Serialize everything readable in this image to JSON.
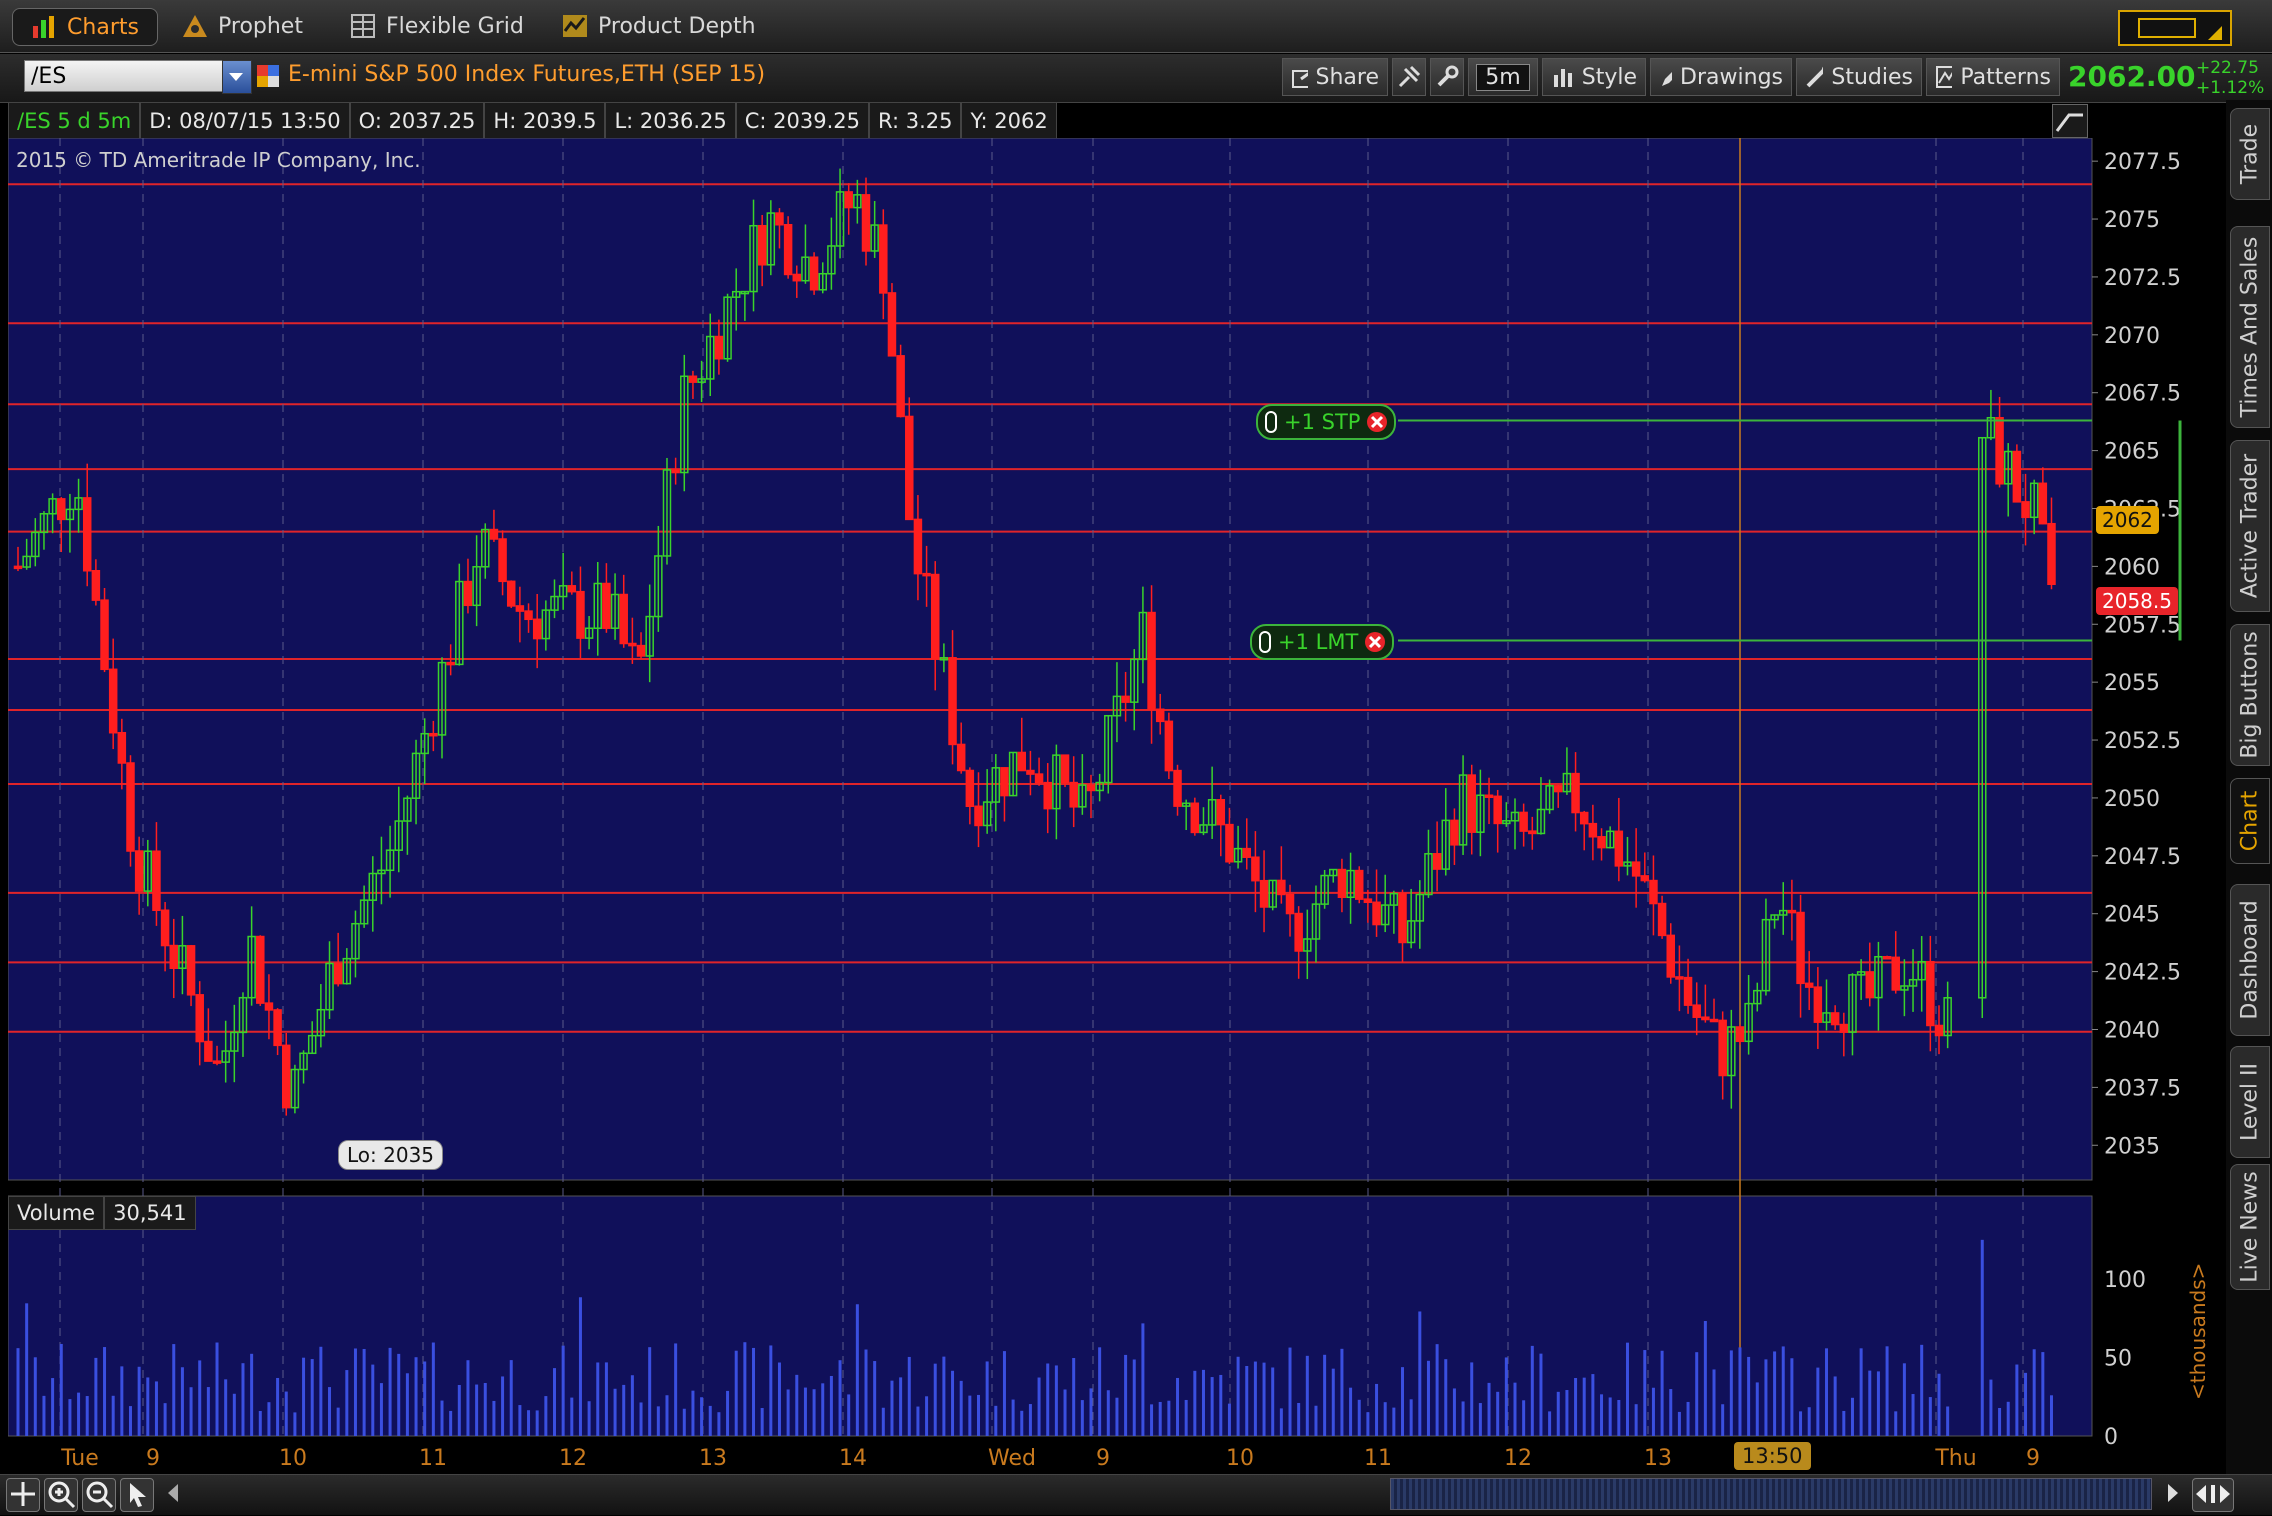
{
  "tabs": [
    {
      "label": "Charts",
      "icon": "charts-icon"
    },
    {
      "label": "Prophet",
      "icon": "prophet-icon"
    },
    {
      "label": "Flexible Grid",
      "icon": "grid-icon"
    },
    {
      "label": "Product Depth",
      "icon": "depth-icon"
    }
  ],
  "header": {
    "symbol": "/ES",
    "description": "E-mini S&P 500 Index Futures,ETH (SEP 15)",
    "buttons": {
      "share": "Share",
      "timeframe": "5m",
      "style": "Style",
      "drawings": "Drawings",
      "studies": "Studies",
      "patterns": "Patterns"
    },
    "last_price": "2062.00",
    "net_change": "+22.75",
    "pct_change": "+1.12%"
  },
  "info": {
    "period": "/ES 5 d 5m",
    "date": "D: 08/07/15 13:50",
    "open": "O: 2037.25",
    "high": "H: 2039.5",
    "low": "L: 2036.25",
    "close": "C: 2039.25",
    "range": "R: 3.25",
    "y": "Y: 2062"
  },
  "chart": {
    "copyright": "2015 © TD Ameritrade IP Company, Inc.",
    "lo_label": "Lo: 2035",
    "price_badge": "2062",
    "bid_badge": "2058.5",
    "orders": {
      "stop": "+1 STP",
      "limit": "+1 LMT"
    },
    "volume_label": "Volume",
    "volume_value": "30,541",
    "volume_unit": "<thousands>",
    "cursor_time": "13:50"
  },
  "chart_data": {
    "type": "candlestick",
    "price_axis": {
      "min": 2033.5,
      "max": 2078.5,
      "ticks": [
        "2077.5",
        "2075",
        "2072.5",
        "2070",
        "2067.5",
        "2065",
        "2062.5",
        "2060",
        "2057.5",
        "2055",
        "2052.5",
        "2050",
        "2047.5",
        "2045",
        "2042.5",
        "2040",
        "2037.5",
        "2035"
      ]
    },
    "volume_axis": {
      "max": 130,
      "ticks": [
        "100",
        "50",
        "0"
      ]
    },
    "x_labels": [
      "Tue",
      "9",
      "10",
      "11",
      "12",
      "13",
      "14",
      "Wed",
      "9",
      "10",
      "11",
      "12",
      "13",
      "Thu",
      "9"
    ],
    "horizontal_levels": [
      2076.5,
      2070.5,
      2067,
      2064.2,
      2061.5,
      2056,
      2053.8,
      2050.6,
      2045.9,
      2042.9,
      2039.9
    ],
    "orders": {
      "stop": 2066.3,
      "limit": 2056.8
    },
    "last": 2062,
    "bid": 2058.5,
    "low": 2035,
    "waypoints": [
      [
        0,
        2060
      ],
      [
        20,
        2064
      ],
      [
        40,
        2048
      ],
      [
        70,
        2038
      ],
      [
        80,
        2044
      ],
      [
        95,
        2037
      ],
      [
        110,
        2043
      ],
      [
        130,
        2048
      ],
      [
        160,
        2061
      ],
      [
        175,
        2058
      ],
      [
        205,
        2058
      ],
      [
        215,
        2055
      ],
      [
        230,
        2067
      ],
      [
        260,
        2075
      ],
      [
        275,
        2073
      ],
      [
        290,
        2076
      ],
      [
        300,
        2073
      ],
      [
        310,
        2061
      ],
      [
        330,
        2050
      ],
      [
        350,
        2052
      ],
      [
        370,
        2049
      ],
      [
        390,
        2057
      ],
      [
        400,
        2051
      ],
      [
        420,
        2048
      ],
      [
        440,
        2044
      ],
      [
        460,
        2047
      ],
      [
        480,
        2044
      ],
      [
        500,
        2050
      ],
      [
        520,
        2048
      ],
      [
        540,
        2050
      ],
      [
        560,
        2047
      ],
      [
        580,
        2041
      ],
      [
        590,
        2039
      ],
      [
        600,
        2040
      ],
      [
        610,
        2046
      ],
      [
        620,
        2042
      ],
      [
        640,
        2041
      ],
      [
        655,
        2043
      ],
      [
        670,
        2040
      ],
      [
        680,
        2066
      ],
      [
        700,
        2062
      ],
      [
        705,
        2058
      ]
    ],
    "total_bars": 712,
    "gap_ranges": [
      [
        671,
        679
      ]
    ]
  },
  "right_tabs": [
    "Trade",
    "Times And Sales",
    "Active Trader",
    "Big Buttons",
    "Chart",
    "Dashboard",
    "Level II",
    "Live News"
  ]
}
